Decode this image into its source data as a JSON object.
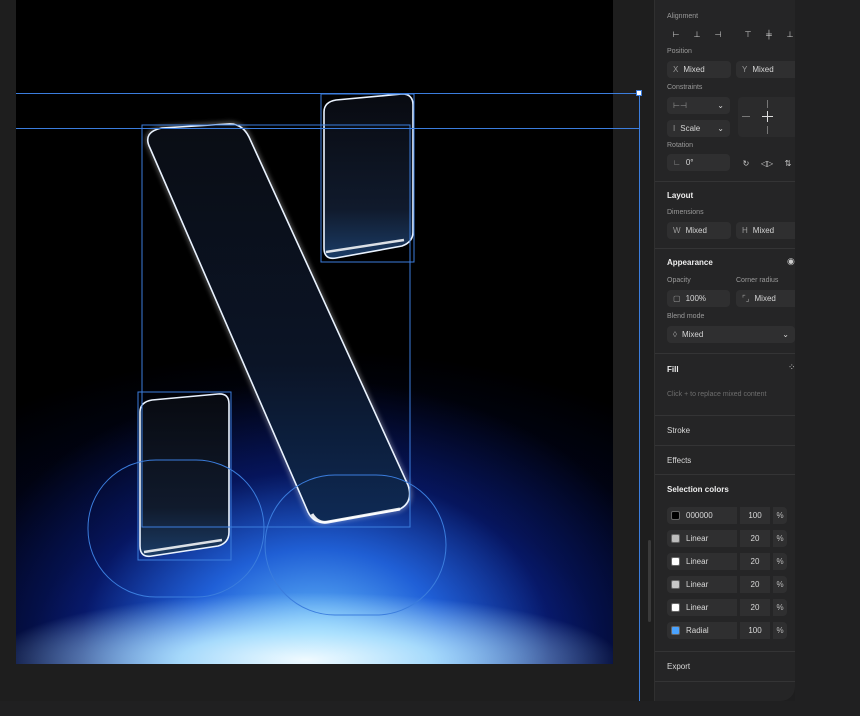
{
  "panel": {
    "alignment": {
      "label": "Alignment"
    },
    "position": {
      "label": "Position",
      "x_prefix": "X",
      "x_value": "Mixed",
      "y_prefix": "Y",
      "y_value": "Mixed"
    },
    "constraints": {
      "label": "Constraints",
      "vertical": "Scale"
    },
    "rotation": {
      "label": "Rotation",
      "value": "0°"
    },
    "layout": {
      "title": "Layout",
      "dimensions_label": "Dimensions",
      "w_prefix": "W",
      "w_value": "Mixed",
      "h_prefix": "H",
      "h_value": "Mixed"
    },
    "appearance": {
      "title": "Appearance",
      "opacity_label": "Opacity",
      "opacity_value": "100%",
      "radius_label": "Corner radius",
      "radius_value": "Mixed",
      "blend_label": "Blend mode",
      "blend_value": "Mixed"
    },
    "fill": {
      "title": "Fill",
      "hint": "Click + to replace mixed content"
    },
    "stroke": {
      "title": "Stroke"
    },
    "effects": {
      "title": "Effects"
    },
    "selection_colors": {
      "title": "Selection colors",
      "rows": [
        {
          "name": "000000",
          "value": "100",
          "unit": "%",
          "swatch": "#000000"
        },
        {
          "name": "Linear",
          "value": "20",
          "unit": "%",
          "swatch": "#bdbdbd"
        },
        {
          "name": "Linear",
          "value": "20",
          "unit": "%",
          "swatch": "#ffffff"
        },
        {
          "name": "Linear",
          "value": "20",
          "unit": "%",
          "swatch": "#c8c8c8"
        },
        {
          "name": "Linear",
          "value": "20",
          "unit": "%",
          "swatch": "#ffffff"
        },
        {
          "name": "Radial",
          "value": "100",
          "unit": "%",
          "swatch": "#4aa3ff"
        }
      ]
    },
    "export": {
      "title": "Export"
    }
  },
  "colors": {
    "selection": "#3b7ddd",
    "panel_bg": "#252526",
    "canvas_bg": "#1e1e1e"
  }
}
